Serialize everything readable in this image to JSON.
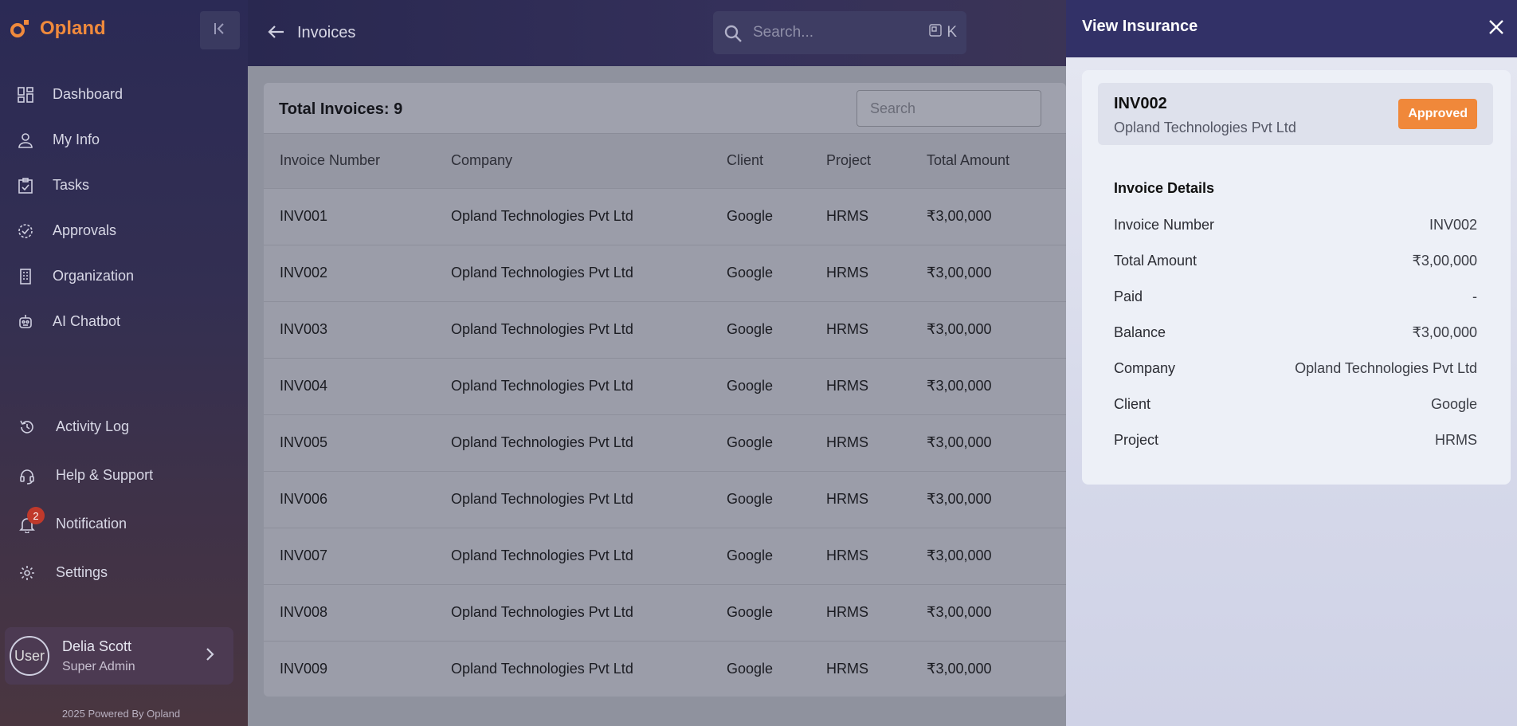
{
  "app": {
    "name": "Opland"
  },
  "sidebar": {
    "items": [
      {
        "label": "Dashboard",
        "icon": "dashboard-icon"
      },
      {
        "label": "My Info",
        "icon": "user-icon"
      },
      {
        "label": "Tasks",
        "icon": "tasks-icon"
      },
      {
        "label": "Approvals",
        "icon": "approvals-icon"
      },
      {
        "label": "Organization",
        "icon": "building-icon"
      },
      {
        "label": "AI Chatbot",
        "icon": "robot-icon"
      }
    ],
    "bottom_items": [
      {
        "label": "Activity Log",
        "icon": "history-icon"
      },
      {
        "label": "Help & Support",
        "icon": "headset-icon"
      },
      {
        "label": "Notification",
        "icon": "bell-icon"
      },
      {
        "label": "Settings",
        "icon": "gear-icon"
      }
    ],
    "notification_count": "2",
    "user": {
      "name": "Delia Scott",
      "role": "Super Admin",
      "avatar_alt": "User"
    },
    "footer": "2025 Powered By Opland"
  },
  "header": {
    "title": "Invoices",
    "search_placeholder": "Search...",
    "shortcut_key": "K"
  },
  "invoices": {
    "total_label": "Total Invoices: 9",
    "search_placeholder": "Search",
    "columns": [
      "Invoice Number",
      "Company",
      "Client",
      "Project",
      "Total Amount"
    ],
    "rows": [
      [
        "INV001",
        "Opland Technologies Pvt Ltd",
        "Google",
        "HRMS",
        "₹3,00,000"
      ],
      [
        "INV002",
        "Opland Technologies Pvt Ltd",
        "Google",
        "HRMS",
        "₹3,00,000"
      ],
      [
        "INV003",
        "Opland Technologies Pvt Ltd",
        "Google",
        "HRMS",
        "₹3,00,000"
      ],
      [
        "INV004",
        "Opland Technologies Pvt Ltd",
        "Google",
        "HRMS",
        "₹3,00,000"
      ],
      [
        "INV005",
        "Opland Technologies Pvt Ltd",
        "Google",
        "HRMS",
        "₹3,00,000"
      ],
      [
        "INV006",
        "Opland Technologies Pvt Ltd",
        "Google",
        "HRMS",
        "₹3,00,000"
      ],
      [
        "INV007",
        "Opland Technologies Pvt Ltd",
        "Google",
        "HRMS",
        "₹3,00,000"
      ],
      [
        "INV008",
        "Opland Technologies Pvt Ltd",
        "Google",
        "HRMS",
        "₹3,00,000"
      ],
      [
        "INV009",
        "Opland Technologies Pvt Ltd",
        "Google",
        "HRMS",
        "₹3,00,000"
      ]
    ]
  },
  "drawer": {
    "title": "View Insurance",
    "invoice_number": "INV002",
    "company": "Opland Technologies Pvt Ltd",
    "status": "Approved",
    "details_title": "Invoice Details",
    "details": [
      {
        "label": "Invoice Number",
        "value": "INV002"
      },
      {
        "label": "Total Amount",
        "value": "₹3,00,000"
      },
      {
        "label": "Paid",
        "value": "-"
      },
      {
        "label": "Balance",
        "value": "₹3,00,000"
      },
      {
        "label": "Company",
        "value": "Opland Technologies Pvt Ltd"
      },
      {
        "label": "Client",
        "value": "Google"
      },
      {
        "label": "Project",
        "value": "HRMS"
      }
    ]
  },
  "colors": {
    "accent": "#f08a3c",
    "drawer_header": "#323167",
    "status_approved": "#f0883a"
  }
}
